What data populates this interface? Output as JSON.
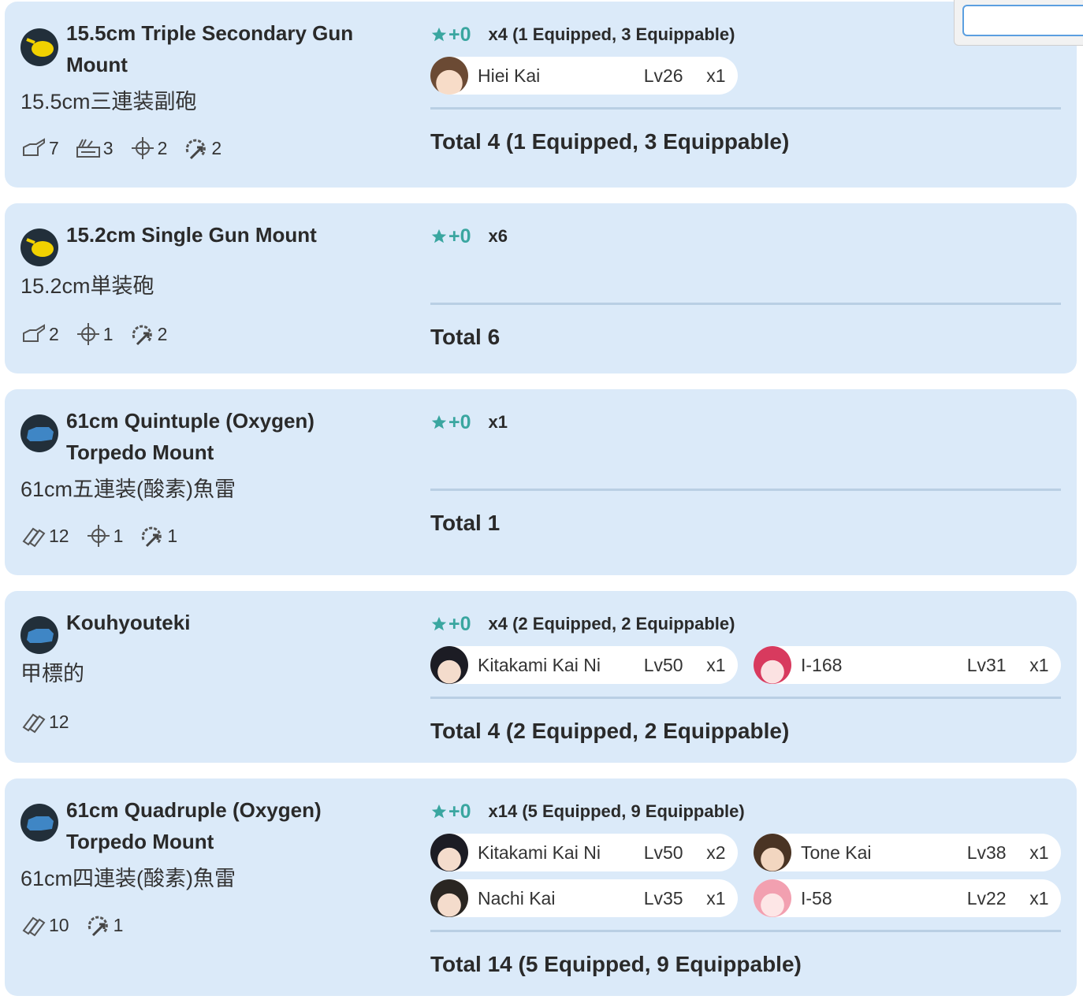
{
  "search": {
    "placeholder": "",
    "value": ""
  },
  "colors": {
    "card_bg": "#dbeaf9",
    "improvement": "#3aa6a0",
    "gun_icon": "#f1d100",
    "torpedo_icon": "#3f86c5"
  },
  "items": [
    {
      "name": "15.5cm Triple Secondary Gun Mount",
      "name_lines": [
        "15.5cm Triple Secondary Gun",
        "Mount"
      ],
      "jp_name": "15.5cm三連装副砲",
      "type_icon": "secondary-gun-icon",
      "stats": [
        {
          "icon": "firepower-icon",
          "value": "7"
        },
        {
          "icon": "aa-icon",
          "value": "3"
        },
        {
          "icon": "accuracy-icon",
          "value": "2"
        },
        {
          "icon": "evasion-icon",
          "value": "2"
        }
      ],
      "improvement": "+0",
      "count": "x4 (1 Equipped, 3 Equippable)",
      "ships": [
        {
          "name": "Hiei Kai",
          "level": "Lv26",
          "count": "x1",
          "avatar": "hiei"
        }
      ],
      "total": "Total 4 (1 Equipped, 3 Equippable)"
    },
    {
      "name": "15.2cm Single Gun Mount",
      "name_lines": [
        "15.2cm Single Gun Mount"
      ],
      "jp_name": "15.2cm単装砲",
      "type_icon": "secondary-gun-icon",
      "stats": [
        {
          "icon": "firepower-icon",
          "value": "2"
        },
        {
          "icon": "accuracy-icon",
          "value": "1"
        },
        {
          "icon": "evasion-icon",
          "value": "2"
        }
      ],
      "improvement": "+0",
      "count": "x6",
      "ships": [],
      "total": "Total 6"
    },
    {
      "name": "61cm Quintuple (Oxygen) Torpedo Mount",
      "name_lines": [
        "61cm Quintuple (Oxygen)",
        "Torpedo Mount"
      ],
      "jp_name": "61cm五連装(酸素)魚雷",
      "type_icon": "torpedo-icon",
      "stats": [
        {
          "icon": "torpedo-stat-icon",
          "value": "12"
        },
        {
          "icon": "accuracy-icon",
          "value": "1"
        },
        {
          "icon": "evasion-icon",
          "value": "1"
        }
      ],
      "improvement": "+0",
      "count": "x1",
      "ships": [],
      "total": "Total 1"
    },
    {
      "name": "Kouhyouteki",
      "name_lines": [
        "Kouhyouteki"
      ],
      "jp_name": "甲標的",
      "type_icon": "torpedo-icon",
      "stats": [
        {
          "icon": "torpedo-stat-icon",
          "value": "12"
        }
      ],
      "improvement": "+0",
      "count": "x4 (2 Equipped, 2 Equippable)",
      "ships": [
        {
          "name": "Kitakami Kai Ni",
          "level": "Lv50",
          "count": "x1",
          "avatar": "kitakami"
        },
        {
          "name": "I-168",
          "level": "Lv31",
          "count": "x1",
          "avatar": "i168"
        }
      ],
      "total": "Total 4 (2 Equipped, 2 Equippable)"
    },
    {
      "name": "61cm Quadruple (Oxygen) Torpedo Mount",
      "name_lines": [
        "61cm Quadruple (Oxygen)",
        "Torpedo Mount"
      ],
      "jp_name": "61cm四連装(酸素)魚雷",
      "type_icon": "torpedo-icon",
      "stats": [
        {
          "icon": "torpedo-stat-icon",
          "value": "10"
        },
        {
          "icon": "evasion-icon",
          "value": "1"
        }
      ],
      "improvement": "+0",
      "count": "x14 (5 Equipped, 9 Equippable)",
      "ships": [
        {
          "name": "Kitakami Kai Ni",
          "level": "Lv50",
          "count": "x2",
          "avatar": "kitakami"
        },
        {
          "name": "Tone Kai",
          "level": "Lv38",
          "count": "x1",
          "avatar": "tone"
        },
        {
          "name": "Nachi Kai",
          "level": "Lv35",
          "count": "x1",
          "avatar": "nachi"
        },
        {
          "name": "I-58",
          "level": "Lv22",
          "count": "x1",
          "avatar": "i58"
        }
      ],
      "total": "Total 14 (5 Equipped, 9 Equippable)"
    }
  ]
}
